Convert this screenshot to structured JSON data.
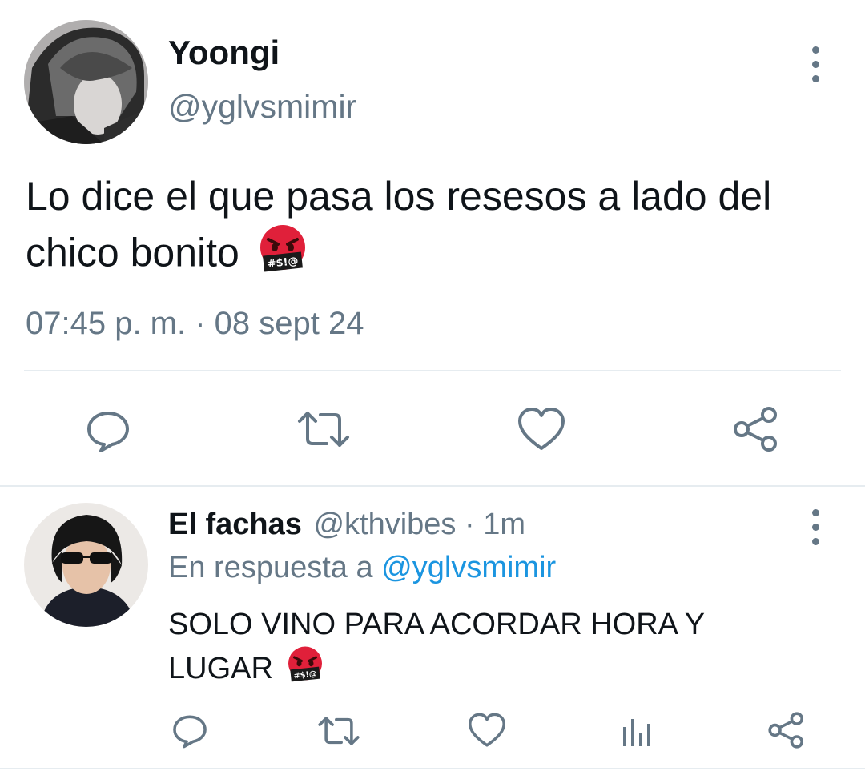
{
  "main_tweet": {
    "display_name": "Yoongi",
    "handle": "@yglvsmimir",
    "text": "Lo dice el que pasa los resesos a lado del chico bonito",
    "emoji": "#$!@",
    "timestamp": "07:45 p. m. · 08 sept 24"
  },
  "reply_tweet": {
    "display_name": "El fachas",
    "handle": "@kthvibes",
    "time_ago": "· 1m",
    "reply_prefix": "En respuesta a",
    "reply_handle": "@yglvsmimir",
    "text": "SOLO VINO PARA ACORDAR HORA Y LUGAR",
    "emoji": "#$!@"
  },
  "icons": {
    "reply": "reply-icon",
    "retweet": "retweet-icon",
    "like": "heart-icon",
    "share": "share-icon",
    "analytics": "analytics-icon",
    "more": "more-vertical-icon"
  },
  "colors": {
    "text": "#0f1419",
    "muted": "#657786",
    "link": "#1b95e0",
    "divider": "#e6ecf0",
    "angry_emoji": "#e0203a"
  }
}
